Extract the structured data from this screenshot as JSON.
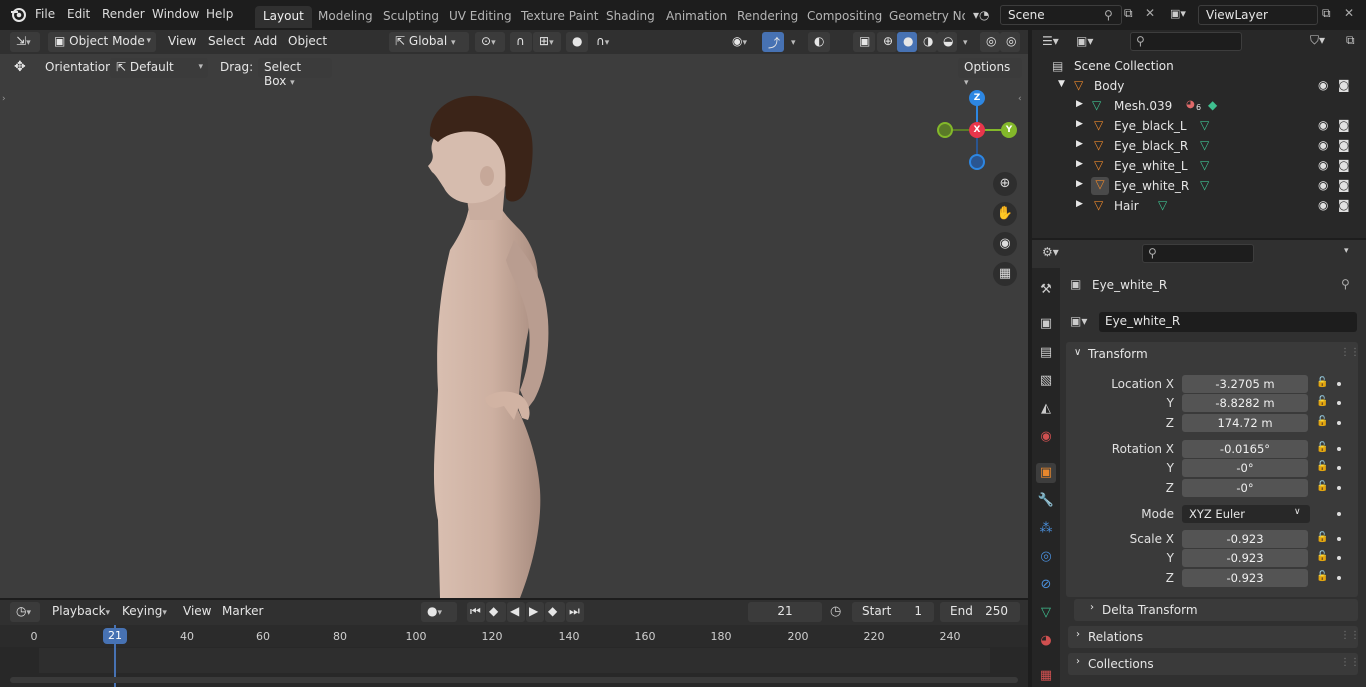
{
  "topbar": {
    "menus": [
      "File",
      "Edit",
      "Render",
      "Window",
      "Help"
    ],
    "workspaces": [
      "Layout",
      "Modeling",
      "Sculpting",
      "UV Editing",
      "Texture Paint",
      "Shading",
      "Animation",
      "Rendering",
      "Compositing",
      "Geometry Noc"
    ],
    "active_workspace": "Layout",
    "scene": "Scene",
    "view_layer": "ViewLayer"
  },
  "viewport_header": {
    "mode": "Object Mode",
    "menus": [
      "View",
      "Select",
      "Add",
      "Object"
    ],
    "transform_orientation": "Global"
  },
  "tool_header": {
    "orientation_label": "Orientation:",
    "orientation_value": "Default",
    "drag_label": "Drag:",
    "drag_value": "Select Box",
    "options": "Options"
  },
  "gizmo": {
    "x": "X",
    "y": "Y",
    "z": "Z"
  },
  "timeline": {
    "playback": "Playback",
    "keying": "Keying",
    "view": "View",
    "marker": "Marker",
    "current_frame": "21",
    "start_label": "Start",
    "start": "1",
    "end_label": "End",
    "end": "250",
    "ticks": [
      "0",
      "21",
      "40",
      "60",
      "80",
      "100",
      "120",
      "140",
      "160",
      "180",
      "200",
      "220",
      "240"
    ]
  },
  "outliner": {
    "root": "Scene Collection",
    "collection": "Body",
    "items": [
      {
        "name": "Mesh.039",
        "type": "mesh"
      },
      {
        "name": "Eye_black_L",
        "type": "object"
      },
      {
        "name": "Eye_black_R",
        "type": "object"
      },
      {
        "name": "Eye_white_L",
        "type": "object"
      },
      {
        "name": "Eye_white_R",
        "type": "object"
      },
      {
        "name": "Hair",
        "type": "object"
      }
    ],
    "mesh_badge": "6"
  },
  "properties": {
    "object_name": "Eye_white_R",
    "datablock_name": "Eye_white_R",
    "transform_label": "Transform",
    "location_label": "Location X",
    "rotation_label": "Rotation X",
    "scale_label": "Scale X",
    "y_label": "Y",
    "z_label": "Z",
    "mode_label": "Mode",
    "location": [
      "-3.2705 m",
      "-8.8282 m",
      "174.72 m"
    ],
    "rotation": [
      "-0.0165°",
      "-0°",
      "-0°"
    ],
    "rotation_mode": "XYZ Euler",
    "scale": [
      "-0.923",
      "-0.923",
      "-0.923"
    ],
    "delta_transform": "Delta Transform",
    "relations": "Relations",
    "collections": "Collections"
  },
  "colors": {
    "accent_blue": "#4772b3",
    "object_orange": "#e8872d",
    "x_axis": "#e8364b",
    "y_axis": "#83b82a",
    "z_axis": "#2d87e3"
  }
}
